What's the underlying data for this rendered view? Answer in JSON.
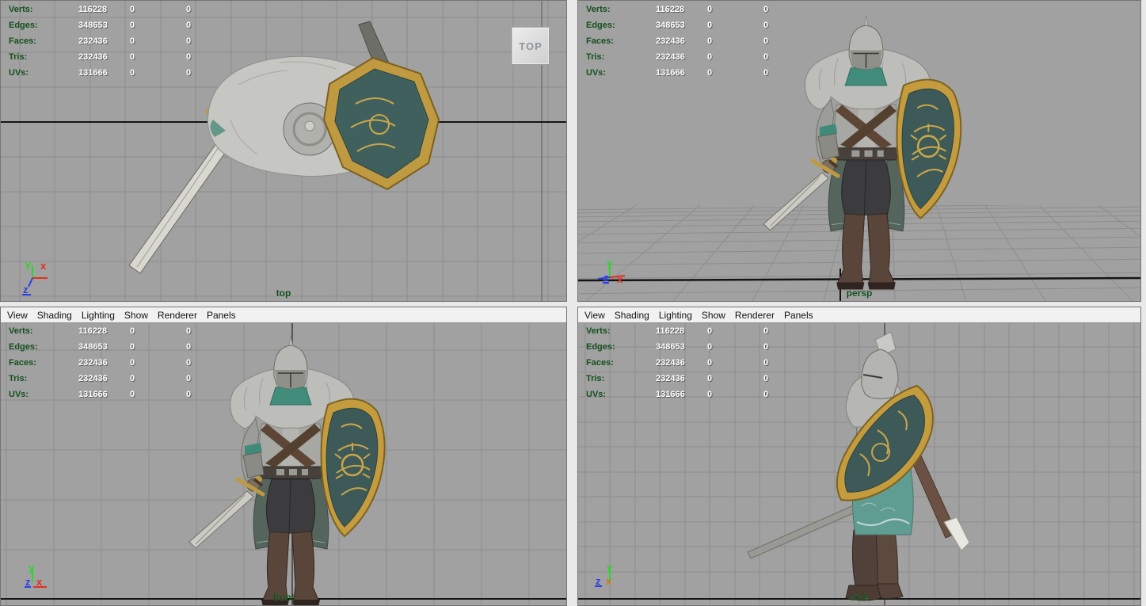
{
  "colors": {
    "viewport_bg": "#a1a1a1",
    "grid_line": "#8d8d8d",
    "axis_black": "#141414",
    "hud_label_green": "#14501d",
    "hud_value_white": "#ffffff",
    "menu_bg": "#f1f1f1",
    "menu_text": "#111111",
    "armor_silver": "#b7b7b3",
    "fur_gray": "#bdbdb9",
    "scarf_teal": "#418c7b",
    "skirt_teal": "#5f9c92",
    "shield_gold": "#c49c3e",
    "shield_field": "#3d5a58",
    "boot_brown": "#59453a",
    "axis_x_red": "#e03020",
    "axis_y_green": "#2fd42f",
    "axis_z_blue": "#2a3fe8"
  },
  "menu": {
    "items": [
      "View",
      "Shading",
      "Lighting",
      "Show",
      "Renderer",
      "Panels"
    ]
  },
  "hud": {
    "rows": [
      {
        "label": "Verts:",
        "total": "116228",
        "sel": "0",
        "comp": "0"
      },
      {
        "label": "Edges:",
        "total": "348653",
        "sel": "0",
        "comp": "0"
      },
      {
        "label": "Faces:",
        "total": "232436",
        "sel": "0",
        "comp": "0"
      },
      {
        "label": "Tris:",
        "total": "232436",
        "sel": "0",
        "comp": "0"
      },
      {
        "label": "UVs:",
        "total": "131666",
        "sel": "0",
        "comp": "0"
      }
    ]
  },
  "axes": {
    "x": "x",
    "y": "y",
    "z": "z"
  },
  "viewports": {
    "top_left": {
      "label": "top"
    },
    "top_right": {
      "label": "persp"
    },
    "bottom_left": {
      "label": "front"
    },
    "bottom_right": {
      "label": "side"
    }
  },
  "view_cube": {
    "label": "TOP"
  }
}
